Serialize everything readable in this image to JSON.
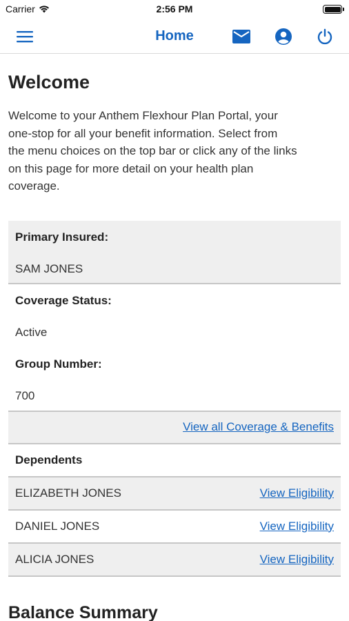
{
  "status_bar": {
    "carrier": "Carrier",
    "time": "2:56 PM"
  },
  "nav": {
    "title": "Home",
    "icons": [
      "menu-icon",
      "mail-icon",
      "account-icon",
      "power-icon"
    ]
  },
  "welcome": {
    "heading": "Welcome",
    "intro_lines": [
      "Welcome to your Anthem Flexhour Plan Portal, your",
      "one-stop for all your benefit information.  Select from",
      "the menu choices on the top bar or click any of the links",
      "on this page for more detail on your health plan",
      "coverage."
    ]
  },
  "coverage": {
    "primary_label": "Primary Insured:",
    "primary_value": "SAM JONES",
    "status_label": "Coverage Status:",
    "status_value": "Active",
    "group_label": "Group Number:",
    "group_value": "700",
    "view_all_link": "View all Coverage & Benefits"
  },
  "dependents": {
    "heading": "Dependents",
    "items": [
      {
        "name": "ELIZABETH JONES",
        "link": "View Eligibility"
      },
      {
        "name": "DANIEL JONES",
        "link": "View Eligibility"
      },
      {
        "name": "ALICIA JONES",
        "link": "View Eligibility"
      }
    ]
  },
  "balance": {
    "heading": "Balance Summary"
  },
  "colors": {
    "accent": "#1565c0",
    "row_gray": "#efefef",
    "divider": "#c6c6c6"
  }
}
